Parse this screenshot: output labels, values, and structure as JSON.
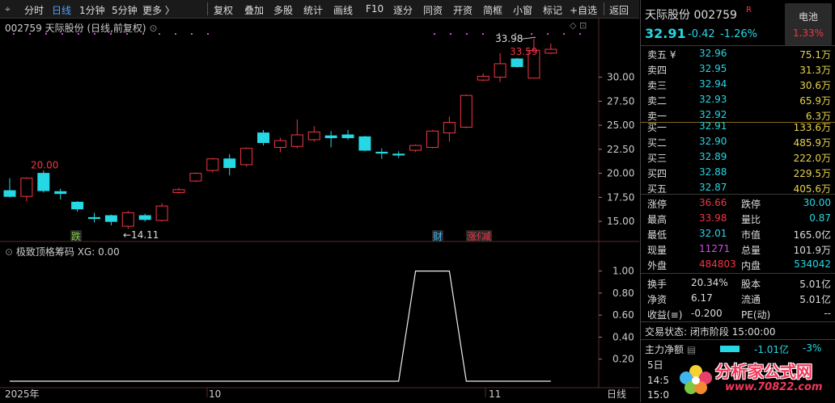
{
  "toolbar": {
    "items": [
      "分时",
      "日线",
      "1分钟",
      "5分钟",
      "更多 〉",
      "复权",
      "叠加",
      "多股",
      "统计",
      "画线",
      "F10",
      "逐分",
      "同资",
      "开资",
      "简框",
      "小窗",
      "标记",
      "+自选",
      "返回"
    ],
    "active": "日线"
  },
  "chart": {
    "header": "002759 天际股份 (日线,前复权)",
    "high_label": "33.98",
    "last_label": "33.59",
    "prev_high_label": "20.00",
    "low_label": "14.11",
    "event_tags": [
      "跌",
      "财",
      "涨停",
      "减"
    ],
    "y_ticks": [
      "30.00",
      "27.50",
      "25.00",
      "22.50",
      "20.00",
      "17.50",
      "15.00"
    ],
    "x_ticks": [
      "2025年",
      "10",
      "11"
    ],
    "period_label": "日线",
    "colors": {
      "up": "#f23645",
      "down": "#25d8e4",
      "grid": "#3a1a1a",
      "dot": "#d24be0"
    }
  },
  "chart_data": [
    {
      "type": "candlestick",
      "title": "002759 天际股份 (日线,前复权)",
      "ylim": [
        13.5,
        34.5
      ],
      "candles": [
        {
          "o": 18.2,
          "c": 17.6,
          "h": 19.5,
          "l": 17.5
        },
        {
          "o": 17.6,
          "c": 19.5,
          "h": 19.6,
          "l": 17.1
        },
        {
          "o": 20.0,
          "c": 18.2,
          "h": 20.3,
          "l": 18.0
        },
        {
          "o": 18.1,
          "c": 17.9,
          "h": 18.4,
          "l": 17.3
        },
        {
          "o": 17.0,
          "c": 16.3,
          "h": 17.1,
          "l": 16.0
        },
        {
          "o": 15.4,
          "c": 15.3,
          "h": 15.9,
          "l": 14.9
        },
        {
          "o": 15.6,
          "c": 15.0,
          "h": 15.7,
          "l": 14.6
        },
        {
          "o": 14.5,
          "c": 15.9,
          "h": 16.1,
          "l": 14.2
        },
        {
          "o": 15.6,
          "c": 15.2,
          "h": 15.8,
          "l": 15.0
        },
        {
          "o": 15.1,
          "c": 16.6,
          "h": 16.9,
          "l": 15.0
        },
        {
          "o": 18.0,
          "c": 18.3,
          "h": 18.5,
          "l": 17.9
        },
        {
          "o": 19.2,
          "c": 20.0,
          "h": 20.1,
          "l": 19.1
        },
        {
          "o": 20.3,
          "c": 21.5,
          "h": 21.6,
          "l": 20.1
        },
        {
          "o": 21.5,
          "c": 20.6,
          "h": 22.0,
          "l": 19.8
        },
        {
          "o": 20.9,
          "c": 22.6,
          "h": 22.7,
          "l": 20.7
        },
        {
          "o": 24.2,
          "c": 23.2,
          "h": 24.5,
          "l": 22.9
        },
        {
          "o": 22.7,
          "c": 23.4,
          "h": 23.7,
          "l": 22.2
        },
        {
          "o": 22.8,
          "c": 24.0,
          "h": 25.6,
          "l": 22.6
        },
        {
          "o": 23.5,
          "c": 24.3,
          "h": 24.9,
          "l": 23.3
        },
        {
          "o": 23.9,
          "c": 23.7,
          "h": 24.4,
          "l": 22.7
        },
        {
          "o": 24.0,
          "c": 23.7,
          "h": 24.5,
          "l": 23.5
        },
        {
          "o": 23.8,
          "c": 22.4,
          "h": 23.9,
          "l": 22.3
        },
        {
          "o": 22.2,
          "c": 22.1,
          "h": 22.6,
          "l": 21.5
        },
        {
          "o": 22.0,
          "c": 21.9,
          "h": 22.3,
          "l": 21.6
        },
        {
          "o": 22.4,
          "c": 22.9,
          "h": 23.0,
          "l": 22.2
        },
        {
          "o": 22.7,
          "c": 24.4,
          "h": 24.5,
          "l": 22.6
        },
        {
          "o": 24.2,
          "c": 25.3,
          "h": 25.9,
          "l": 23.3
        },
        {
          "o": 24.8,
          "c": 28.1,
          "h": 28.2,
          "l": 24.7
        },
        {
          "o": 29.7,
          "c": 30.1,
          "h": 30.4,
          "l": 29.6
        },
        {
          "o": 30.0,
          "c": 31.4,
          "h": 32.5,
          "l": 29.5
        },
        {
          "o": 31.9,
          "c": 31.1,
          "h": 32.0,
          "l": 31.0
        },
        {
          "o": 29.9,
          "c": 32.8,
          "h": 33.98,
          "l": 29.9
        },
        {
          "o": 32.5,
          "c": 32.9,
          "h": 33.5,
          "l": 32.4
        }
      ]
    },
    {
      "type": "line",
      "title": "极致顶格筹码 XG: 0.00",
      "series": [
        {
          "name": "XG",
          "values": [
            0,
            0,
            0,
            0,
            0,
            0,
            0,
            0,
            0,
            0,
            0,
            0,
            0,
            0,
            0,
            0,
            0,
            0,
            0,
            0,
            0,
            0,
            0,
            0,
            1,
            1,
            1,
            0,
            0,
            0,
            0,
            0,
            0
          ]
        }
      ],
      "ylim": [
        0,
        1.1
      ],
      "y_ticks": [
        "1.00",
        "0.80",
        "0.60",
        "0.40",
        "0.20"
      ]
    }
  ],
  "indicator": {
    "header": "极致顶格筹码 XG: 0.00"
  },
  "quote": {
    "name": "天际股份 002759",
    "r_mark": "R",
    "sector": "电池",
    "sector_pct": "1.33%",
    "price": "32.91",
    "change": "-0.42",
    "change_pct": "-1.26%",
    "asks": [
      {
        "label": "卖五 ¥",
        "price": "32.96",
        "vol": "75.1万"
      },
      {
        "label": "卖四",
        "price": "32.95",
        "vol": "31.3万"
      },
      {
        "label": "卖三",
        "price": "32.94",
        "vol": "30.6万"
      },
      {
        "label": "卖二",
        "price": "32.93",
        "vol": "65.9万"
      },
      {
        "label": "卖一",
        "price": "32.92",
        "vol": "6.3万"
      }
    ],
    "bids": [
      {
        "label": "买一",
        "price": "32.91",
        "vol": "133.6万"
      },
      {
        "label": "买二",
        "price": "32.90",
        "vol": "485.9万"
      },
      {
        "label": "买三",
        "price": "32.89",
        "vol": "222.0万"
      },
      {
        "label": "买四",
        "price": "32.88",
        "vol": "229.5万"
      },
      {
        "label": "买五",
        "price": "32.87",
        "vol": "405.6万"
      }
    ],
    "stats": [
      {
        "l1": "涨停",
        "v1": "36.66",
        "c1": "red",
        "l2": "跌停",
        "v2": "30.00",
        "c2": "green"
      },
      {
        "l1": "最高",
        "v1": "33.98",
        "c1": "red",
        "l2": "量比",
        "v2": "0.87",
        "c2": "green"
      },
      {
        "l1": "最低",
        "v1": "32.01",
        "c1": "green",
        "l2": "市值",
        "v2": "165.0亿",
        "c2": "white"
      },
      {
        "l1": "现量",
        "v1": "11271",
        "c1": "mag",
        "l2": "总量",
        "v2": "101.9万",
        "c2": "white"
      },
      {
        "l1": "外盘",
        "v1": "484803",
        "c1": "red",
        "l2": "内盘",
        "v2": "534042",
        "c2": "green"
      }
    ],
    "stats2": [
      {
        "l1": "换手",
        "v1": "20.34%",
        "l2": "股本",
        "v2": "5.01亿"
      },
      {
        "l1": "净资",
        "v1": "6.17",
        "l2": "流通",
        "v2": "5.01亿"
      },
      {
        "l1": "收益(≡)",
        "v1": "-0.200",
        "l2": "PE(动)",
        "v2": "--"
      }
    ],
    "status": "交易状态: 闭市阶段 15:00:00",
    "fund_label": "主力净额",
    "fund_value": "-1.01亿",
    "fund_pct": "-3%",
    "day_label": "5日",
    "time1": "14:5",
    "time2": "15:0"
  },
  "watermark": {
    "text": "分析家公式网",
    "url": "www.70822.com"
  }
}
